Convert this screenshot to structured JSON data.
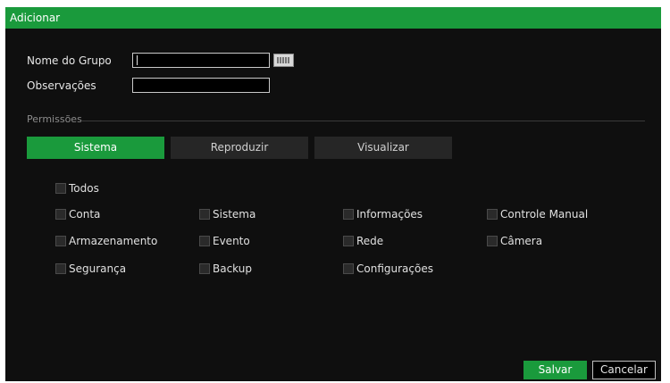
{
  "dialog": {
    "title": "Adicionar"
  },
  "form": {
    "group_name_label": "Nome do Grupo",
    "group_name_value": "",
    "notes_label": "Observações",
    "notes_value": ""
  },
  "permissions": {
    "section_label": "Permissões",
    "tabs": [
      {
        "label": "Sistema",
        "active": true
      },
      {
        "label": "Reproduzir",
        "active": false
      },
      {
        "label": "Visualizar",
        "active": false
      }
    ],
    "all_label": "Todos",
    "items": [
      "Conta",
      "Sistema",
      "Informações",
      "Controle Manual",
      "Armazenamento",
      "Evento",
      "Rede",
      "Câmera",
      "Segurança",
      "Backup",
      "Configurações"
    ]
  },
  "buttons": {
    "save": "Salvar",
    "cancel": "Cancelar"
  },
  "colors": {
    "accent": "#1a9a3c",
    "background": "#0f0f0f"
  }
}
